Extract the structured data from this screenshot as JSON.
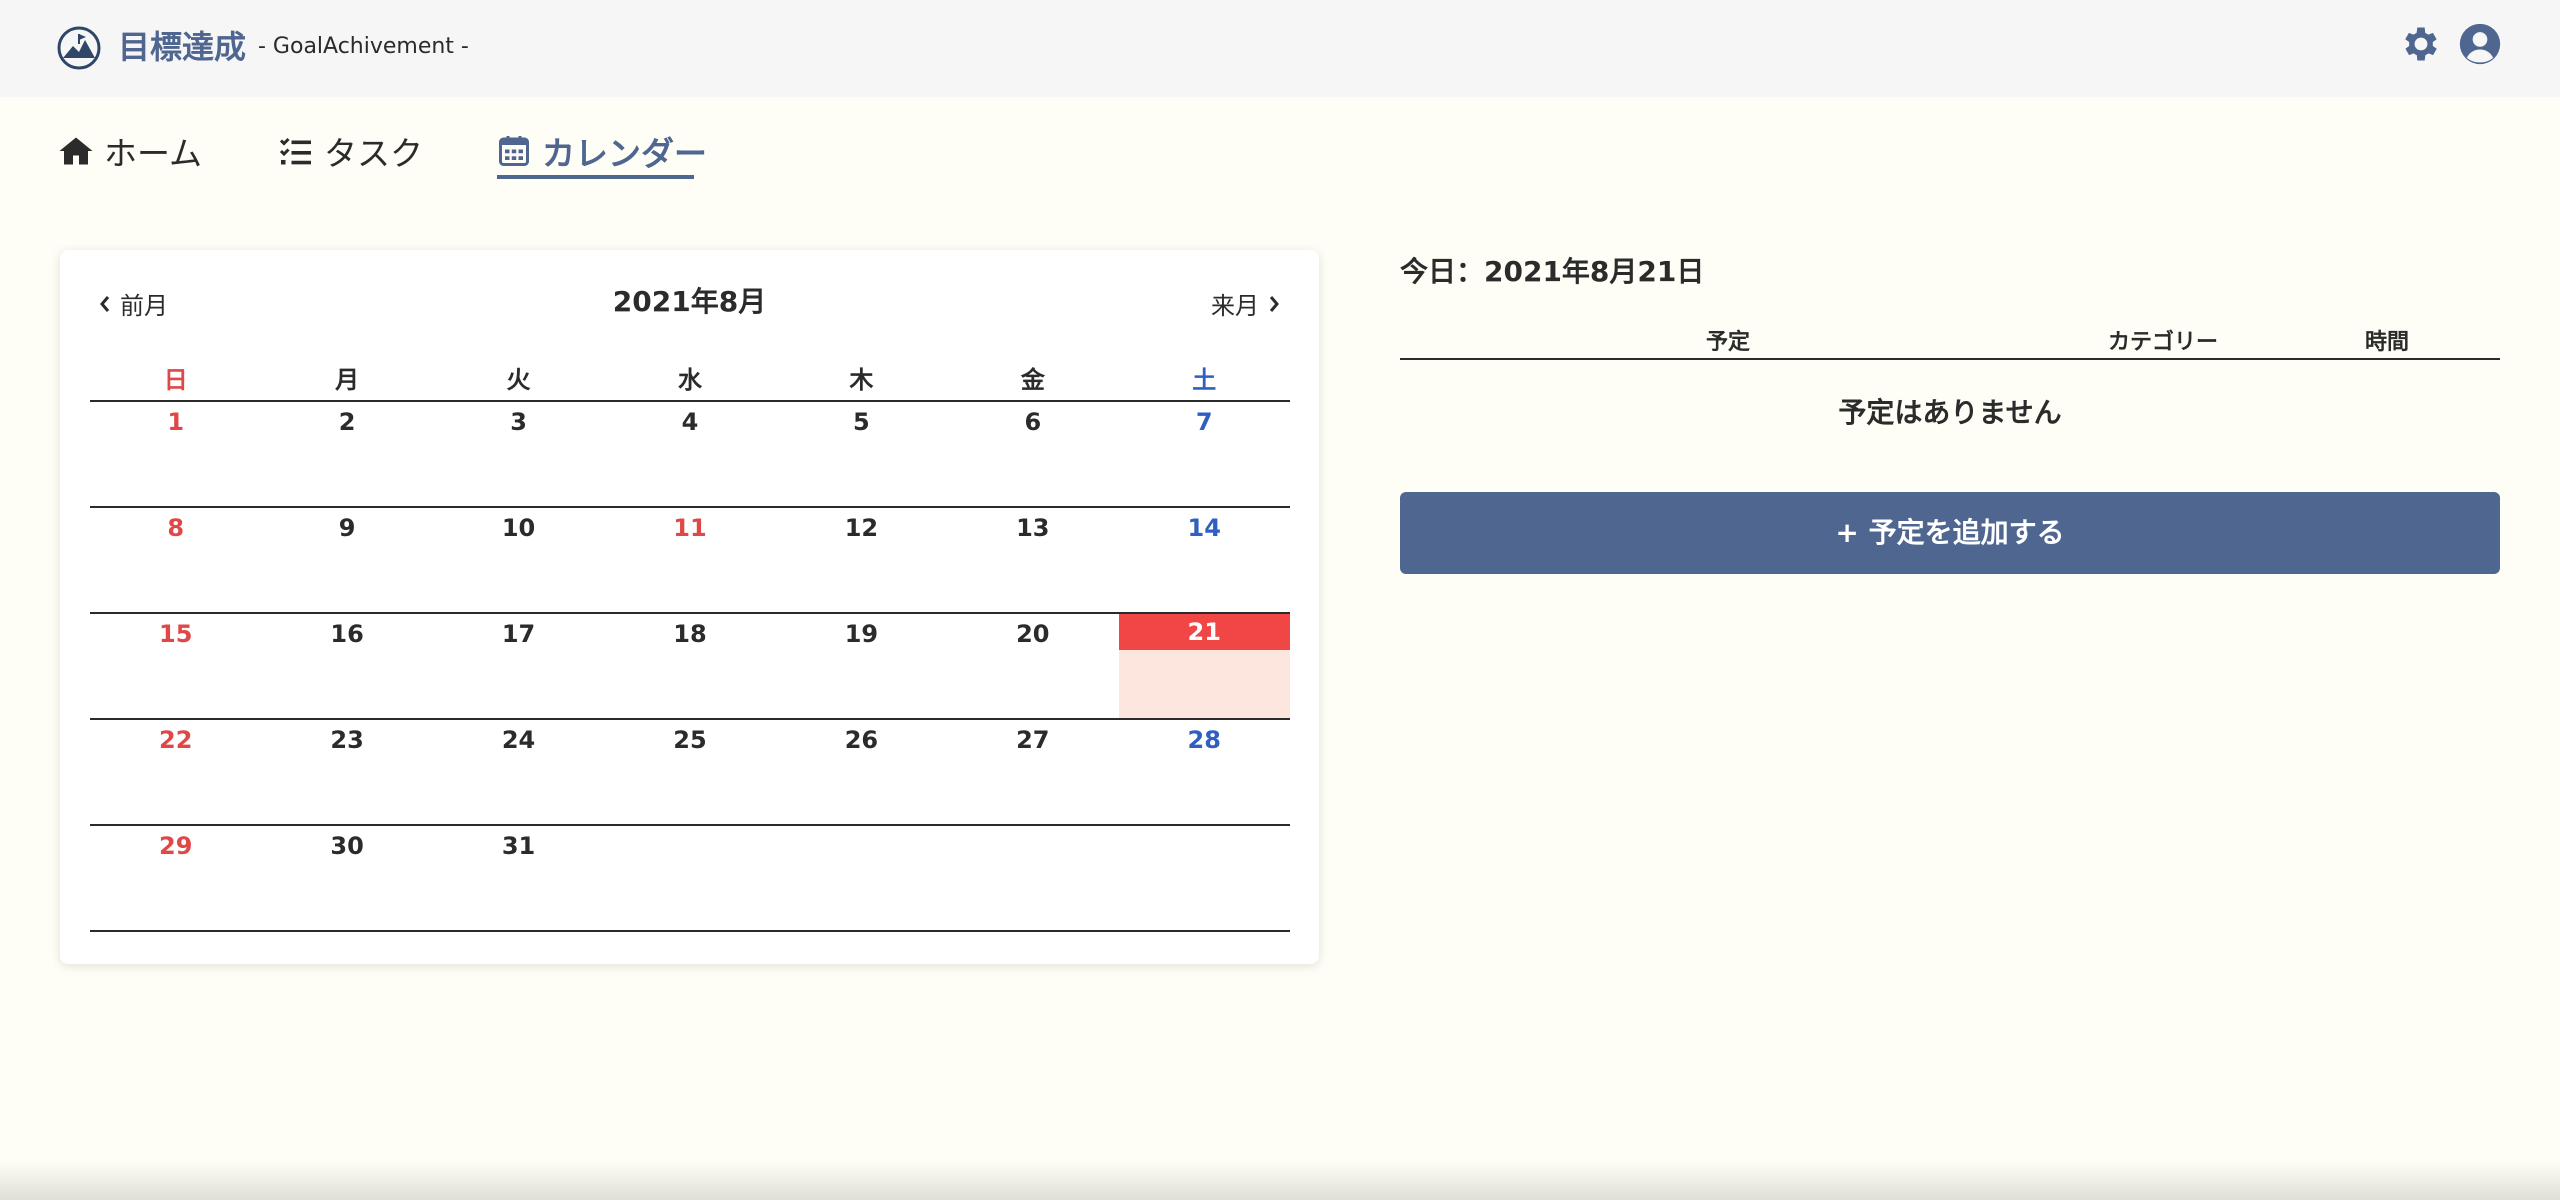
{
  "header": {
    "title": "目標達成",
    "subtitle": "- GoalAchivement -",
    "logo_icon": "mountain-logo-icon",
    "settings_icon": "gear-icon",
    "user_icon": "user-circle-icon"
  },
  "nav": {
    "home": "ホーム",
    "task": "タスク",
    "calendar": "カレンダー",
    "active": "calendar"
  },
  "calendar": {
    "prev_label": "前月",
    "next_label": "来月",
    "month_title": "2021年8月",
    "weekdays": [
      "日",
      "月",
      "火",
      "水",
      "木",
      "金",
      "土"
    ],
    "weeks": [
      [
        "1",
        "2",
        "3",
        "4",
        "5",
        "6",
        "7"
      ],
      [
        "8",
        "9",
        "10",
        "11",
        "12",
        "13",
        "14"
      ],
      [
        "15",
        "16",
        "17",
        "18",
        "19",
        "20",
        "21"
      ],
      [
        "22",
        "23",
        "24",
        "25",
        "26",
        "27",
        "28"
      ],
      [
        "29",
        "30",
        "31",
        "",
        "",
        "",
        ""
      ]
    ],
    "holidays": [
      "11"
    ],
    "today": "21"
  },
  "schedule": {
    "today_label": "今日：2021年8月21日",
    "col_plan": "予定",
    "col_category": "カテゴリー",
    "col_time": "時間",
    "empty_message": "予定はありません",
    "add_button": "+ 予定を追加する"
  },
  "colors": {
    "accent": "#4e6690",
    "sunday": "#e04848",
    "saturday": "#2f5fc0",
    "today_bg": "#f04646",
    "today_cell_bg": "#fde6dd",
    "page_bg": "#fefef6"
  }
}
